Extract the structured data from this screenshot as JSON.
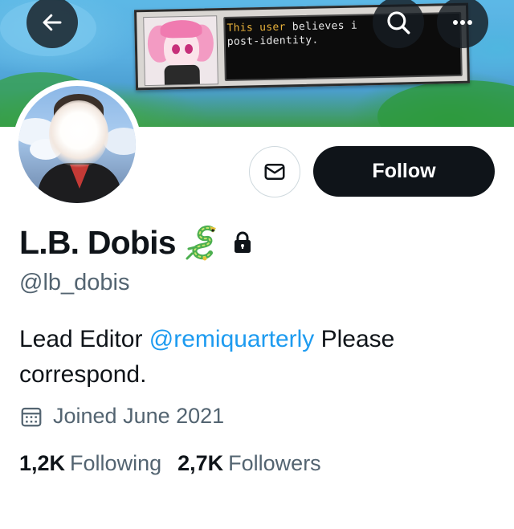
{
  "banner": {
    "sign_text_line1_a": "This user",
    "sign_text_line1_b": " believes i",
    "sign_text_line2": "post-identity."
  },
  "header_buttons": {
    "back": "back-arrow-icon",
    "search": "search-icon",
    "more": "more-dots-icon"
  },
  "profile": {
    "display_name": "L.B. Dobis",
    "name_emoji": "dragon-icon",
    "protected_icon": "lock-icon",
    "handle": "@lb_dobis",
    "bio_prefix": "Lead Editor ",
    "bio_mention": "@remiquarterly",
    "bio_suffix": " Please correspond.",
    "joined": "Joined June 2021",
    "following_count": "1,2K",
    "following_label": "Following",
    "followers_count": "2,7K",
    "followers_label": "Followers"
  },
  "actions": {
    "message_icon": "envelope-icon",
    "follow_label": "Follow"
  },
  "colors": {
    "text_primary": "#0f1419",
    "text_secondary": "#536471",
    "link": "#1d9bf0",
    "button_dark": "#0f1419",
    "border": "#cfd9de"
  }
}
